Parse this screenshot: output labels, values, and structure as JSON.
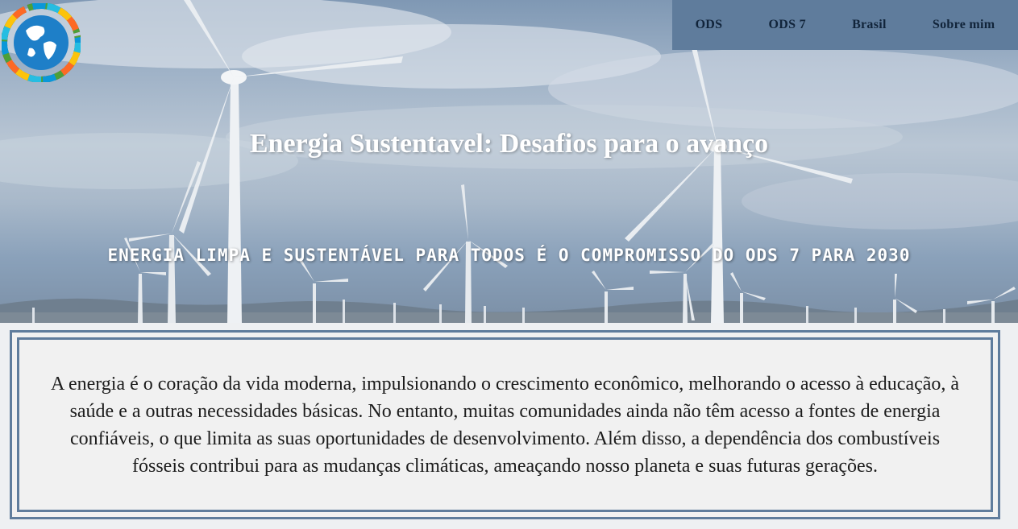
{
  "nav": {
    "items": [
      {
        "label": "ODS"
      },
      {
        "label": "ODS 7"
      },
      {
        "label": "Brasil"
      },
      {
        "label": "Sobre mim"
      }
    ]
  },
  "hero": {
    "title": "Energia Sustentavel: Desafios para o avanço",
    "subtitle": "ENERGIA LIMPA E SUSTENTÁVEL PARA TODOS É O COMPROMISSO DO ODS 7 PARA 2030",
    "background": "wind-turbines-photo"
  },
  "logo": {
    "icon": "sdg-globe-wheel-icon"
  },
  "content": {
    "paragraph": "A energia é o coração da vida moderna, impulsionando o crescimento econômico, melhorando o acesso à educação, à saúde e a outras necessidades básicas. No entanto, muitas comunidades ainda não têm acesso a fontes de energia confiáveis, o que limita as suas oportunidades de desenvolvimento. Além disso, a dependência dos combustíveis fósseis contribui para as mudanças climáticas, ameaçando nosso planeta e suas futuras gerações."
  },
  "colors": {
    "nav_background": "#5f7c9c",
    "nav_text": "#11243a",
    "border": "#5f7c9c",
    "content_background": "#f1f1f1"
  }
}
